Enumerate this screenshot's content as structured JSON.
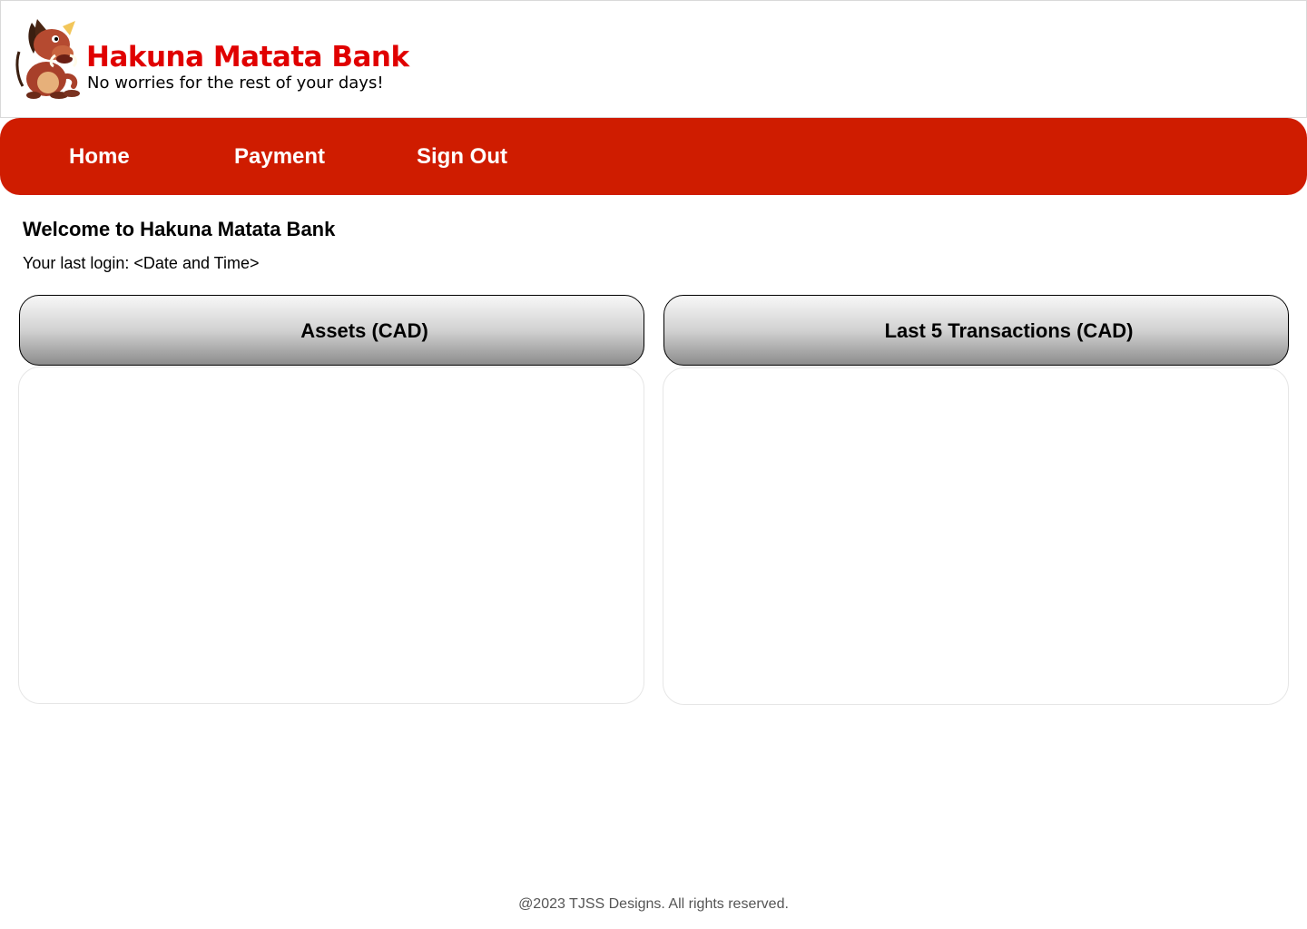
{
  "header": {
    "brand_name": "Hakuna Matata Bank",
    "tagline": "No worries for the rest of your days!",
    "logo_icon": "warthog-mascot-logo"
  },
  "nav": {
    "items": [
      {
        "label": "Home"
      },
      {
        "label": "Payment"
      },
      {
        "label": "Sign Out"
      }
    ],
    "color": "#cf1c00"
  },
  "main": {
    "welcome_title": "Welcome to Hakuna Matata Bank",
    "last_login": "Your last login: <Date and Time>"
  },
  "panels": {
    "assets": {
      "title": "Assets (CAD)"
    },
    "transactions": {
      "title": "Last 5 Transactions (CAD)"
    }
  },
  "footer": {
    "text": "@2023 TJSS Designs. All rights reserved."
  }
}
